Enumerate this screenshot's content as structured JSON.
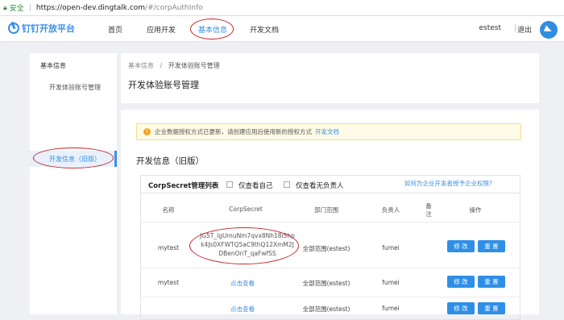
{
  "browser": {
    "secure_label": "安全",
    "url_host": "https://open-dev.dingtalk.com",
    "url_path": "/#/corpAuthInfo"
  },
  "header": {
    "logo_text": "钉钉开放平台",
    "nav": [
      "首页",
      "应用开发",
      "基本信息",
      "开发文档"
    ],
    "username": "estest",
    "logout_label": "退出"
  },
  "sidebar": {
    "title": "基本信息",
    "items": [
      "开发体验账号管理",
      "开发信息（旧版）"
    ]
  },
  "breadcrumb": {
    "root": "基本信息",
    "separator": "/",
    "current": "开发体验账号管理"
  },
  "page_title": "开发体验账号管理",
  "alert": {
    "text": "企业数据授权方式已更新，请创建应用后使用新的授权方式",
    "link": "开发文档"
  },
  "section_title": "开发信息（旧版）",
  "panel": {
    "title": "CorpSecret管理列表",
    "filter_self": "仅查看自己",
    "filter_no_owner": "仅查看无负责人",
    "help_link": "如何为企业开发者授予企业权限?"
  },
  "table": {
    "columns": [
      "名称",
      "CorpSecret",
      "部门范围",
      "负责人",
      "备注",
      "操作"
    ],
    "rows": [
      {
        "name": "mytest",
        "secret": "JG5T_lgUmuNm7qvx8Nh18i5hpk4Js0XFWTQ5aC9thQ12XmM2JDBenOnT_qaFwfSS",
        "dept": "全部范围(estest)",
        "owner": "fumei",
        "edit": "修 改",
        "reset": "重 置"
      },
      {
        "name": "mytest",
        "secret": "点击查看",
        "dept": "全部范围(estest)",
        "owner": "fumei",
        "edit": "修 改",
        "reset": "重 置"
      },
      {
        "name": "",
        "secret": "点击查看",
        "dept": "全部范围(estest)",
        "owner": "fumei",
        "edit": "修 改",
        "reset": "重 置"
      }
    ]
  }
}
